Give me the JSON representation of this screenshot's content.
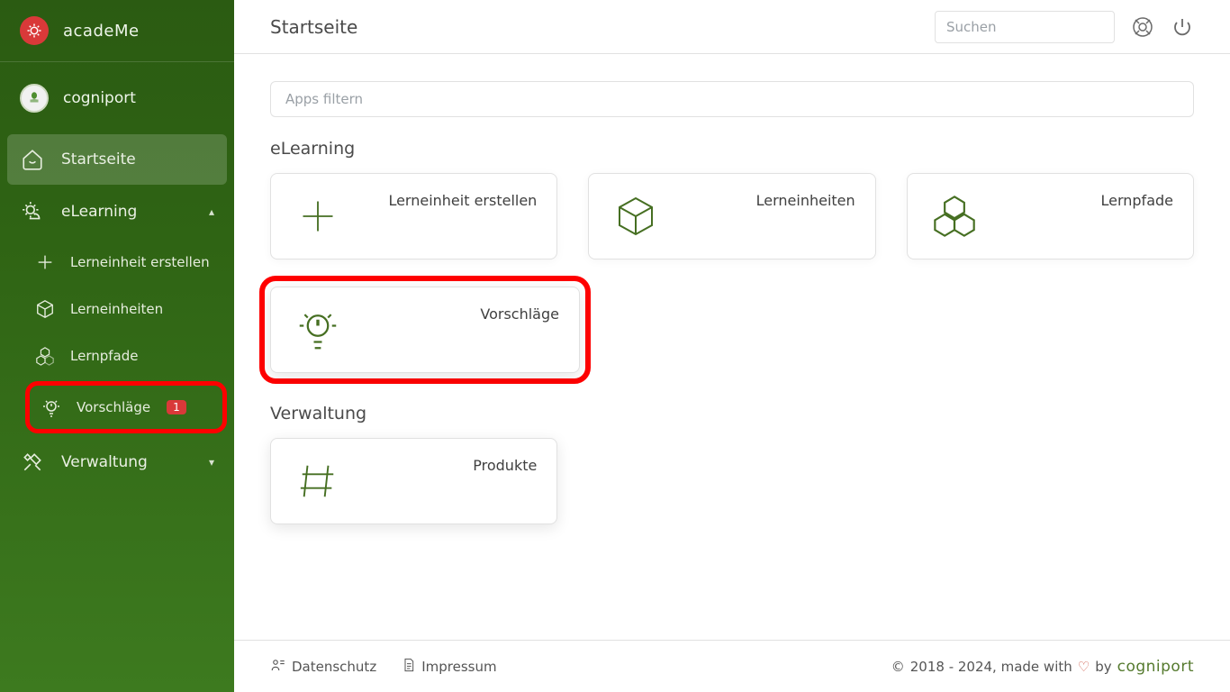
{
  "brand": {
    "name": "acadeMe"
  },
  "tenant": {
    "name": "cogniport"
  },
  "sidebar": {
    "home_label": "Startseite",
    "elearning_label": "eLearning",
    "verwaltung_label": "Verwaltung",
    "sub": {
      "create_label": "Lerneinheit erstellen",
      "units_label": "Lerneinheiten",
      "paths_label": "Lernpfade",
      "suggestions_label": "Vorschläge",
      "suggestions_badge": "1"
    }
  },
  "topbar": {
    "title": "Startseite",
    "search_placeholder": "Suchen"
  },
  "main": {
    "filter_placeholder": "Apps filtern",
    "sections": {
      "elearning_title": "eLearning",
      "verwaltung_title": "Verwaltung"
    },
    "cards": {
      "create_label": "Lerneinheit erstellen",
      "units_label": "Lerneinheiten",
      "paths_label": "Lernpfade",
      "suggestions_label": "Vorschläge",
      "products_label": "Produkte"
    }
  },
  "footer": {
    "privacy_label": "Datenschutz",
    "imprint_label": "Impressum",
    "copyright": "2018 - 2024, made with",
    "by": "by",
    "company": "cogniport"
  }
}
